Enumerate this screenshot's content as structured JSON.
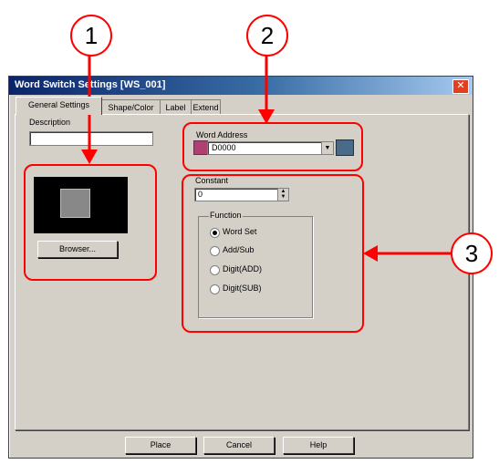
{
  "window": {
    "title": "Word Switch Settings [WS_001]",
    "close_glyph": "✕"
  },
  "tabs": [
    {
      "label": "General Settings",
      "active": true
    },
    {
      "label": "Shape/Color",
      "active": false
    },
    {
      "label": "Label",
      "active": false
    },
    {
      "label": "Extend",
      "active": false
    }
  ],
  "description": {
    "label": "Description",
    "value": ""
  },
  "preview": {
    "browse_label": "Browser..."
  },
  "word_address": {
    "label": "Word Address",
    "value": "D0000"
  },
  "constant": {
    "label": "Constant",
    "value": "0"
  },
  "function": {
    "label": "Function",
    "options": [
      {
        "label": "Word Set",
        "selected": true
      },
      {
        "label": "Add/Sub",
        "selected": false
      },
      {
        "label": "Digit(ADD)",
        "selected": false
      },
      {
        "label": "Digit(SUB)",
        "selected": false
      }
    ]
  },
  "footer": {
    "place_label": "Place",
    "cancel_label": "Cancel",
    "help_label": "Help"
  },
  "annotations": {
    "markers": [
      "1",
      "2",
      "3"
    ],
    "color": "#ff0000"
  }
}
